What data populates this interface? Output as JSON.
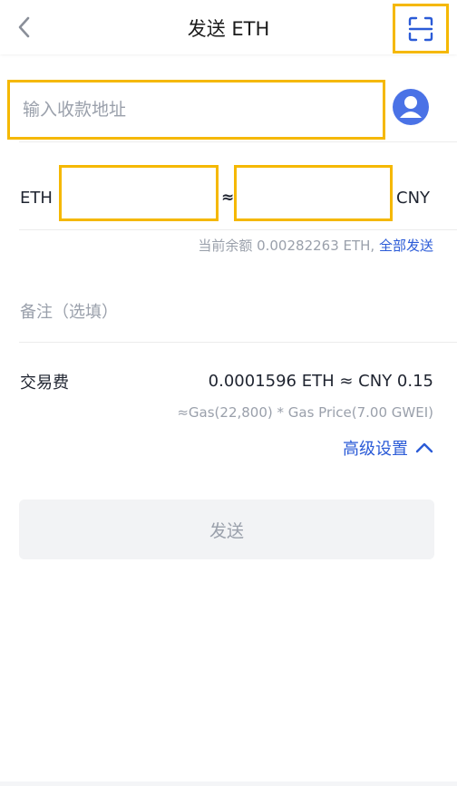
{
  "header": {
    "title": "发送 ETH"
  },
  "address": {
    "placeholder": "输入收款地址"
  },
  "amount": {
    "left_currency": "ETH",
    "approx": "≈",
    "right_currency": "CNY"
  },
  "balance": {
    "text": "当前余额 0.00282263 ETH,",
    "send_all": "全部发送"
  },
  "memo": {
    "placeholder": "备注（选填）"
  },
  "fee": {
    "label": "交易费",
    "value": "0.0001596 ETH ≈ CNY 0.15",
    "detail": "≈Gas(22,800) * Gas Price(7.00 GWEI)",
    "advanced": "高级设置"
  },
  "send_button": {
    "label": "发送"
  },
  "colors": {
    "accent": "#2b5bd7",
    "highlight": "#f5b800",
    "muted": "#9aa0ab"
  },
  "icons": [
    "chevron-left-icon",
    "scan-icon",
    "user-avatar-icon",
    "chevron-up-icon"
  ]
}
